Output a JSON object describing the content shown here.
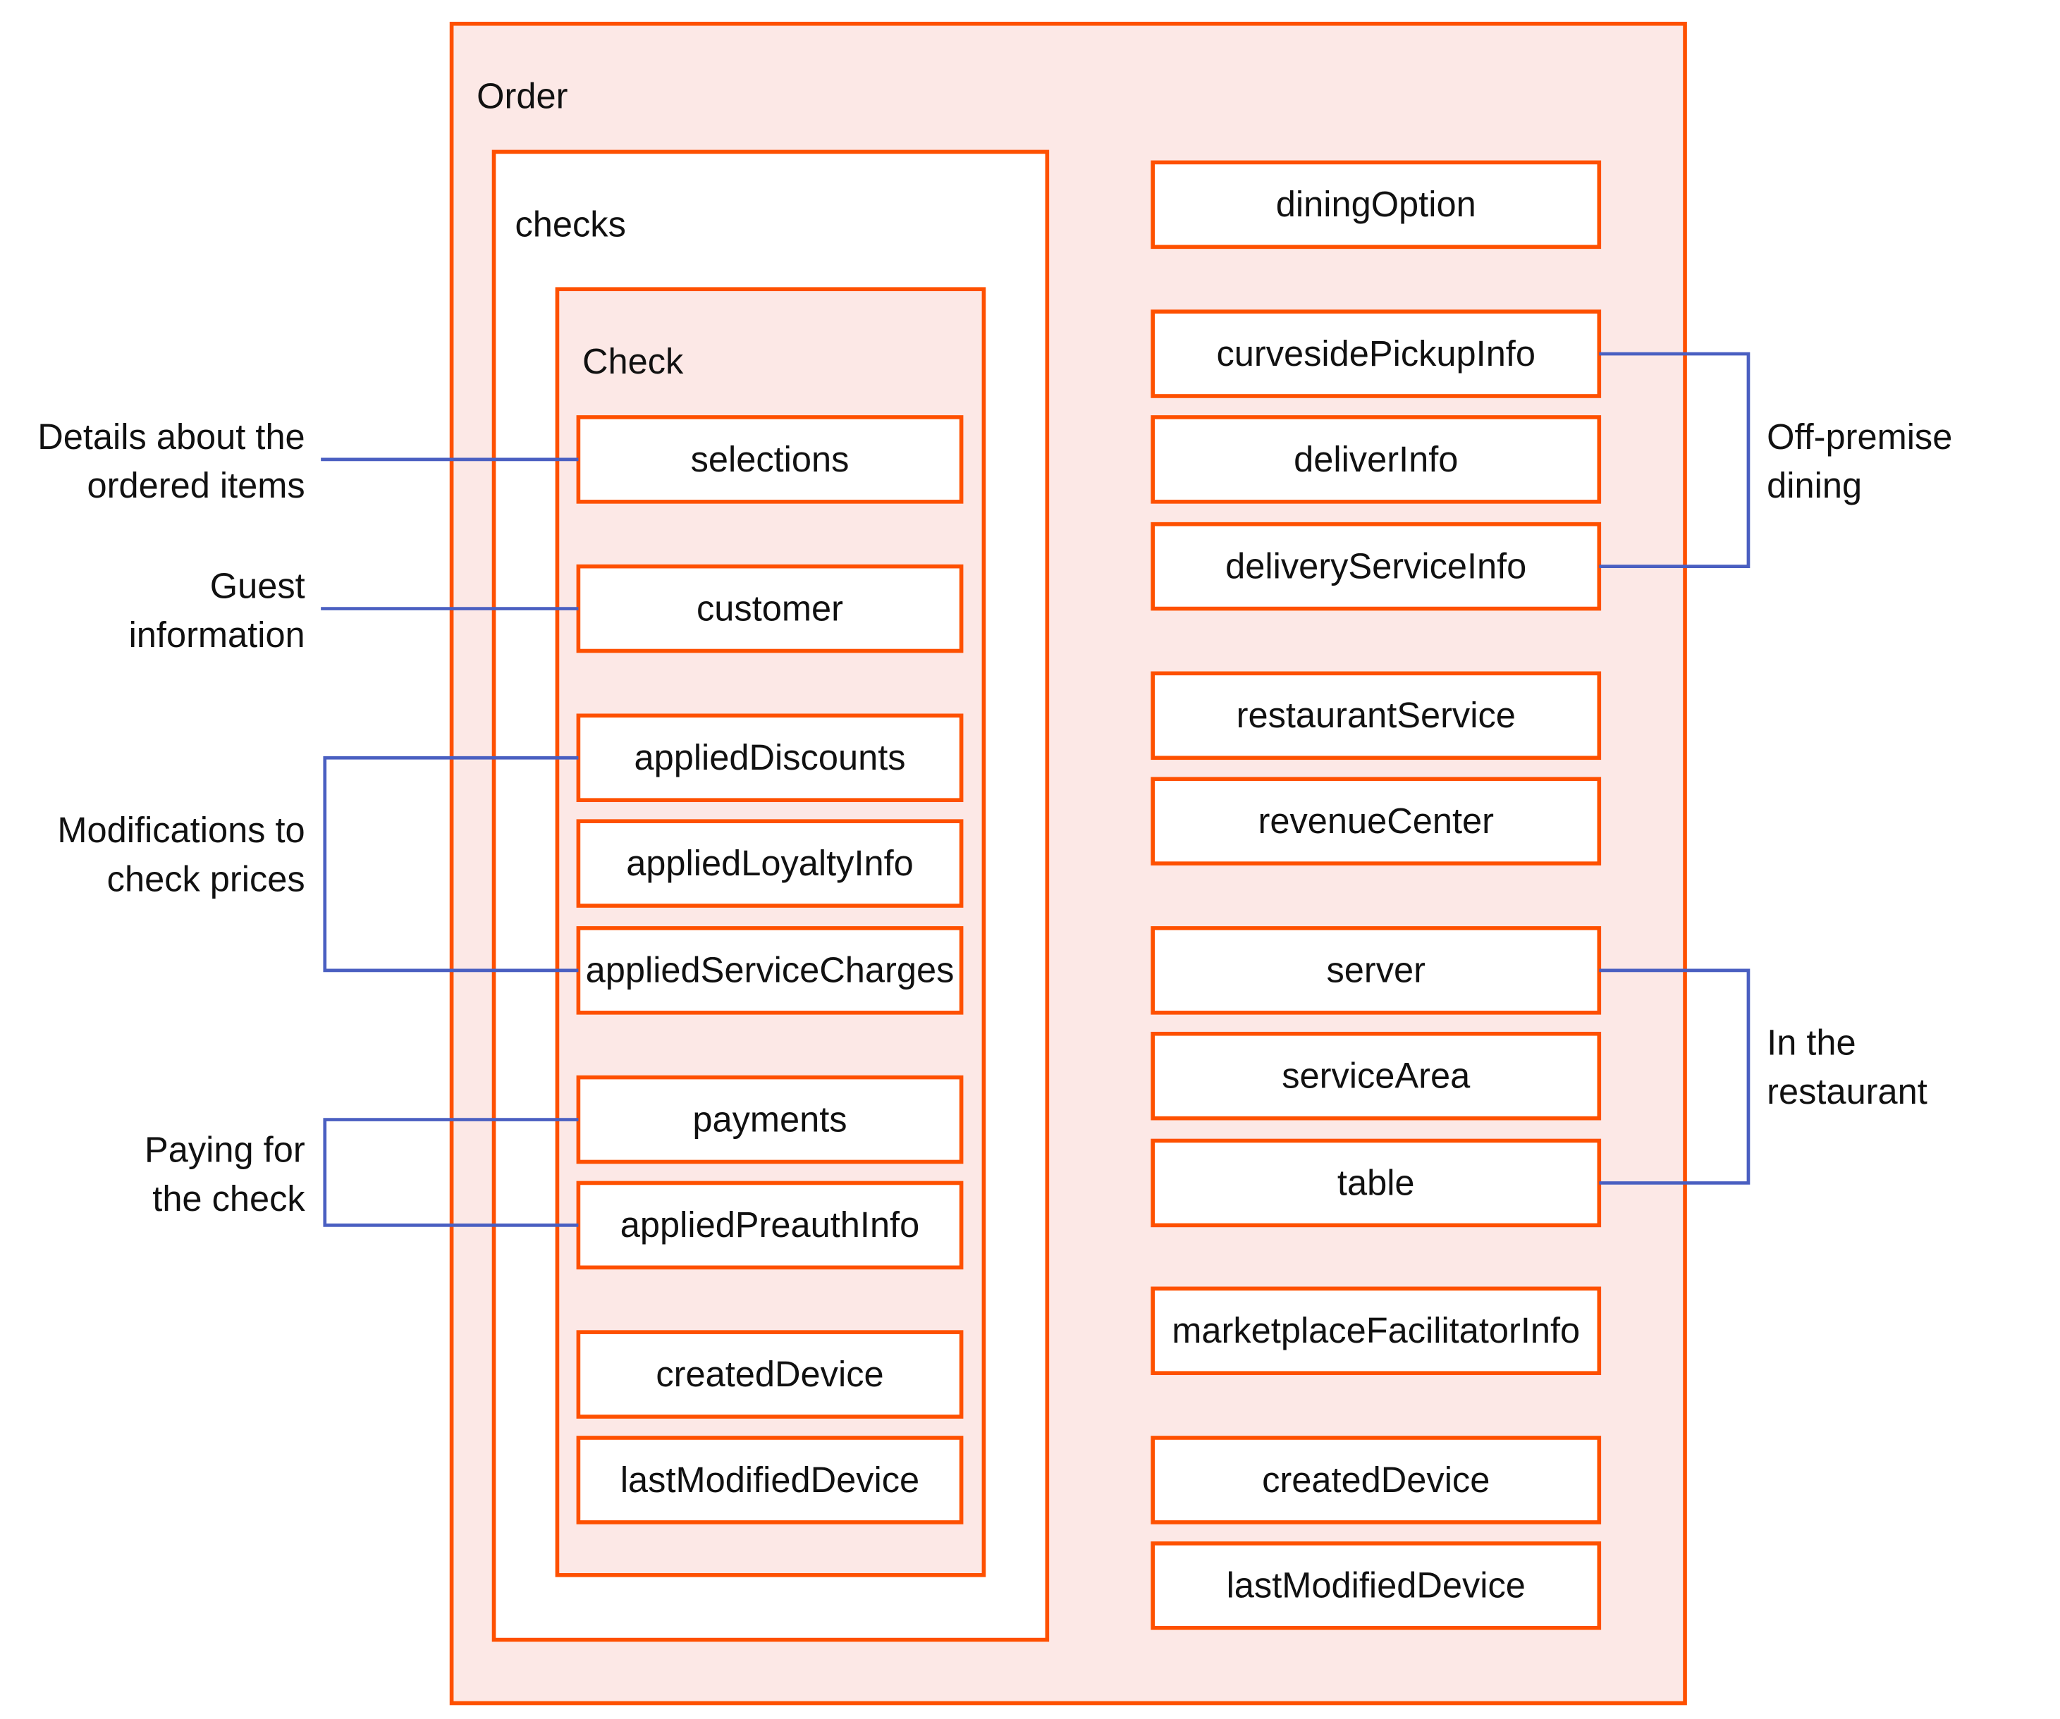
{
  "colors": {
    "border": "#fe5000",
    "container_fill": "#fce8e6",
    "connector": "#4a5fc1",
    "box_fill": "#ffffff"
  },
  "order": {
    "label": "Order",
    "checks": {
      "label": "checks",
      "check": {
        "label": "Check",
        "fields": [
          "selections",
          "customer",
          "appliedDiscounts",
          "appliedLoyaltyInfo",
          "appliedServiceCharges",
          "payments",
          "appliedPreauthInfo",
          "createdDevice",
          "lastModifiedDevice"
        ]
      }
    },
    "fields": [
      "diningOption",
      "curvesidePickupInfo",
      "deliverInfo",
      "deliveryServiceInfo",
      "restaurantService",
      "revenueCenter",
      "server",
      "serviceArea",
      "table",
      "marketplaceFacilitatorInfo",
      "createdDevice",
      "lastModifiedDevice"
    ]
  },
  "annotations": {
    "left": [
      {
        "lines": [
          "Details about the",
          "ordered items"
        ]
      },
      {
        "lines": [
          "Guest",
          "information"
        ]
      },
      {
        "lines": [
          "Modifications to",
          "check prices"
        ]
      },
      {
        "lines": [
          "Paying for",
          "the check"
        ]
      }
    ],
    "right": [
      {
        "lines": [
          "Off-premise",
          "dining"
        ]
      },
      {
        "lines": [
          "In the",
          "restaurant"
        ]
      }
    ]
  }
}
